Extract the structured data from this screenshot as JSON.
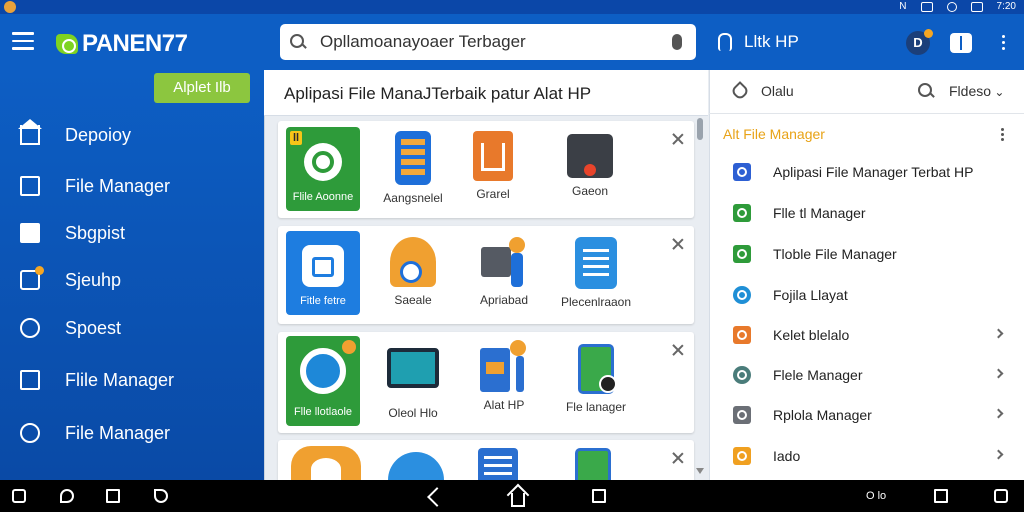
{
  "app": {
    "logo_text": "PANEN77"
  },
  "status_bar": {
    "signal_text": "N",
    "time": "7:20"
  },
  "search": {
    "value": "Opllamoanayoaer Terbager"
  },
  "header": {
    "action_label": "Lltk HP",
    "avatar_letter": "D"
  },
  "sidebar": {
    "install_label": "Alplet Ilb",
    "items": [
      {
        "label": "Depoioy",
        "icon": "home-icon"
      },
      {
        "label": "File Manager",
        "icon": "house-outline-icon"
      },
      {
        "label": "Sbgpist",
        "icon": "document-icon"
      },
      {
        "label": "Sjeuhp",
        "icon": "chat-icon"
      },
      {
        "label": "Spoest",
        "icon": "share-icon"
      },
      {
        "label": "Flile Manager",
        "icon": "bookmark-icon"
      },
      {
        "label": "File Manager",
        "icon": "check-circle-icon"
      }
    ]
  },
  "center": {
    "title": "Aplipasi File ManaJTerbaik patur Alat HP",
    "cards": [
      {
        "apps": [
          {
            "label": "Flile Aoonne",
            "type": "tile",
            "color": "#2e9b3a",
            "badge": "ll"
          },
          {
            "label": "Aangsnelel",
            "type": "icon",
            "color": "#1e6fd9",
            "icon": "phone-apps-icon"
          },
          {
            "label": "Grarel",
            "type": "icon",
            "color": "#e8792b",
            "icon": "chart-icon"
          },
          {
            "label": "Gaeon",
            "type": "icon",
            "color": "#3b3f46",
            "icon": "player-icon"
          }
        ]
      },
      {
        "apps": [
          {
            "label": "Fitle fetre",
            "type": "tile",
            "color": "#1e7de0"
          },
          {
            "label": "Saeale",
            "type": "icon",
            "color": "#f0a030",
            "icon": "tools-icon"
          },
          {
            "label": "Apriabad",
            "type": "icon",
            "color": "#555a63",
            "icon": "person-icon"
          },
          {
            "label": "Plecenlraaon",
            "type": "icon",
            "color": "#2b8fe0",
            "icon": "notes-icon"
          }
        ]
      },
      {
        "apps": [
          {
            "label": "Flle llotlaole",
            "type": "tile",
            "color": "#2e9b3a",
            "badge": ""
          },
          {
            "label": "Oleol Hlo",
            "type": "icon",
            "color": "#1f9fb0",
            "icon": "monitor-icon"
          },
          {
            "label": "Alat HP",
            "type": "icon",
            "color": "#2b6fd0",
            "icon": "stats-icon"
          },
          {
            "label": "Fle lanager",
            "type": "icon",
            "color": "#3aa94a",
            "icon": "phone-icon"
          }
        ]
      },
      {
        "apps": [
          {
            "label": "",
            "type": "icon",
            "color": "#f0a030",
            "icon": "gear-icon"
          },
          {
            "label": "",
            "type": "icon",
            "color": "#2b8fe0",
            "icon": "cloud-icon"
          },
          {
            "label": "",
            "type": "icon",
            "color": "#2b6fd0",
            "icon": "list-icon"
          },
          {
            "label": "",
            "type": "icon",
            "color": "#3aa94a",
            "icon": "phone-icon"
          }
        ]
      }
    ]
  },
  "right_panel": {
    "head_label": "Olalu",
    "sort_label": "Fldeso",
    "section_title": "Alt File Manager",
    "items": [
      {
        "label": "Aplipasi File Manager Terbat HP",
        "color": "#2d5fd3",
        "chevron": false
      },
      {
        "label": "Flle tl Manager",
        "color": "#2e9b3a",
        "chevron": false
      },
      {
        "label": "Tloble File Manager",
        "color": "#2e9b3a",
        "chevron": false
      },
      {
        "label": "Fojila Llayat",
        "color": "#1f8fd6",
        "chevron": false
      },
      {
        "label": "Kelet blelalo",
        "color": "#e8792b",
        "chevron": true
      },
      {
        "label": "Flele Manager",
        "color": "#4a7c7a",
        "chevron": true
      },
      {
        "label": "Rplola Manager",
        "color": "#6b6f76",
        "chevron": true
      },
      {
        "label": "Iado",
        "color": "#f0a020",
        "chevron": true
      }
    ]
  },
  "nav_bar": {
    "indicator_text": "O lo"
  }
}
